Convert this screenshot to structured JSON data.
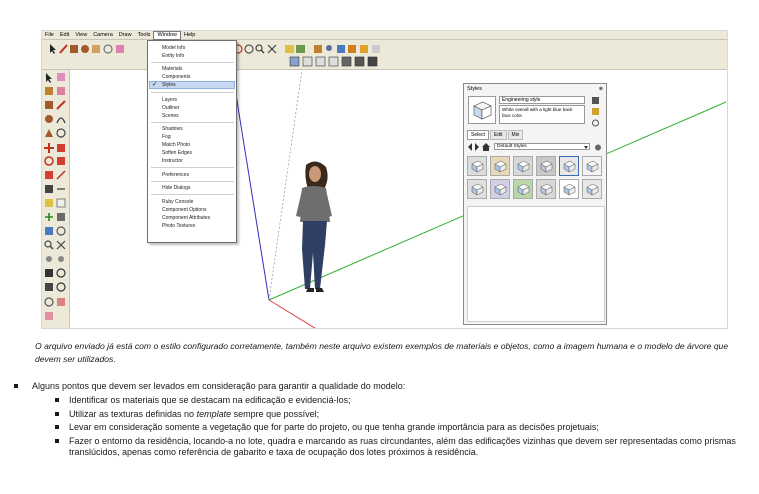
{
  "menubar": {
    "items": [
      "File",
      "Edit",
      "View",
      "Camera",
      "Draw",
      "Tools",
      "Window",
      "Help"
    ],
    "active_index": 6
  },
  "window_menu": {
    "items": [
      {
        "label": "Model Info"
      },
      {
        "label": "Entity Info"
      },
      {
        "label": "Materials"
      },
      {
        "label": "Components"
      },
      {
        "label": "Styles",
        "checked": true,
        "selected": true
      },
      {
        "label": "Layers"
      },
      {
        "label": "Outliner"
      },
      {
        "label": "Scenes"
      },
      {
        "label": "Shadows"
      },
      {
        "label": "Fog"
      },
      {
        "label": "Match Photo"
      },
      {
        "label": "Soften Edges"
      },
      {
        "label": "Instructor"
      },
      {
        "label": "Preferences"
      },
      {
        "label": "Hide Dialogs"
      },
      {
        "label": "Ruby Console"
      },
      {
        "label": "Component Options"
      },
      {
        "label": "Component Attributes"
      },
      {
        "label": "Photo Textures"
      }
    ],
    "check_glyph": "✓"
  },
  "styles_panel": {
    "title": "Styles",
    "close_glyph": "⊗",
    "style_name": "Engineering style",
    "style_description": "White overall with a light blue back face color.",
    "tabs": [
      "Select",
      "Edit",
      "Mix"
    ],
    "active_tab": "Select",
    "collection": "Default Styles",
    "selected_thumbnail_index": 4
  },
  "colors": {
    "axis_red": "#e04040",
    "axis_green": "#30b030",
    "axis_blue": "#3030c0",
    "menu_selected": "#c6d8f0",
    "chrome": "#ece9d8"
  },
  "caption": "O arquivo enviado já está com o estilo configurado corretamente, também neste arquivo existem exemplos de materiais e objetos, como a imagem humana e o modelo de árvore que devem ser utilizados.",
  "bullets": {
    "main": "Alguns pontos que devem ser levados em consideração para garantir a qualidade do modelo:",
    "items": [
      {
        "before": "Identificar os materiais que se destacam na edificação e evidenciá-los;",
        "em": "",
        "after": ""
      },
      {
        "before": "Utilizar as texturas definidas no ",
        "em": "template",
        "after": " sempre que possível;"
      },
      {
        "before": "Levar em consideração somente a vegetação que for parte do projeto, ou que tenha grande importância para as decisões projetuais;",
        "em": "",
        "after": ""
      },
      {
        "before": "Fazer o entorno da residência, locando-a no lote, quadra e marcando as ruas circundantes, além das edificações vizinhas que devem ser representadas como prismas translúcidos, apenas como referência de gabarito e taxa de ocupação dos lotes próximos à residência.",
        "em": "",
        "after": ""
      }
    ]
  }
}
